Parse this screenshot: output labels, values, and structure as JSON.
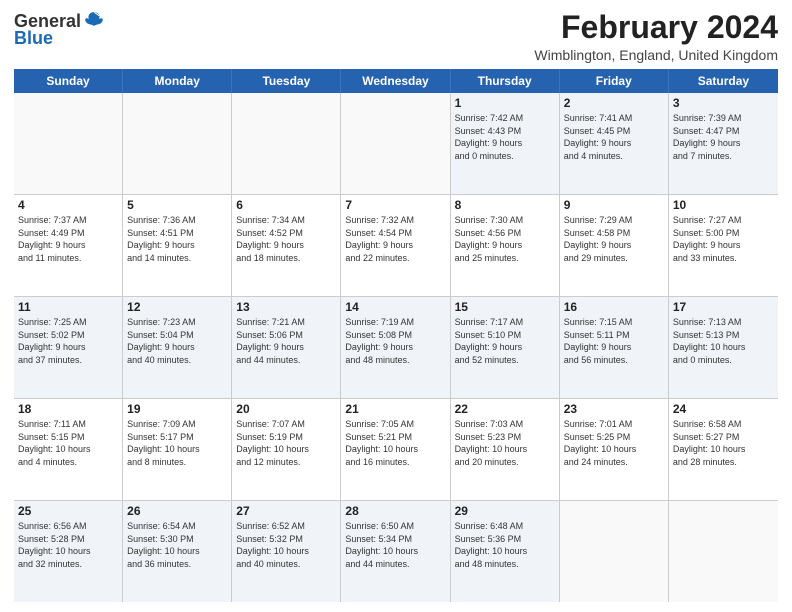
{
  "header": {
    "logo_general": "General",
    "logo_blue": "Blue",
    "month_year": "February 2024",
    "location": "Wimblington, England, United Kingdom"
  },
  "days_of_week": [
    "Sunday",
    "Monday",
    "Tuesday",
    "Wednesday",
    "Thursday",
    "Friday",
    "Saturday"
  ],
  "weeks": [
    [
      {
        "day": "",
        "info": ""
      },
      {
        "day": "",
        "info": ""
      },
      {
        "day": "",
        "info": ""
      },
      {
        "day": "",
        "info": ""
      },
      {
        "day": "1",
        "info": "Sunrise: 7:42 AM\nSunset: 4:43 PM\nDaylight: 9 hours\nand 0 minutes."
      },
      {
        "day": "2",
        "info": "Sunrise: 7:41 AM\nSunset: 4:45 PM\nDaylight: 9 hours\nand 4 minutes."
      },
      {
        "day": "3",
        "info": "Sunrise: 7:39 AM\nSunset: 4:47 PM\nDaylight: 9 hours\nand 7 minutes."
      }
    ],
    [
      {
        "day": "4",
        "info": "Sunrise: 7:37 AM\nSunset: 4:49 PM\nDaylight: 9 hours\nand 11 minutes."
      },
      {
        "day": "5",
        "info": "Sunrise: 7:36 AM\nSunset: 4:51 PM\nDaylight: 9 hours\nand 14 minutes."
      },
      {
        "day": "6",
        "info": "Sunrise: 7:34 AM\nSunset: 4:52 PM\nDaylight: 9 hours\nand 18 minutes."
      },
      {
        "day": "7",
        "info": "Sunrise: 7:32 AM\nSunset: 4:54 PM\nDaylight: 9 hours\nand 22 minutes."
      },
      {
        "day": "8",
        "info": "Sunrise: 7:30 AM\nSunset: 4:56 PM\nDaylight: 9 hours\nand 25 minutes."
      },
      {
        "day": "9",
        "info": "Sunrise: 7:29 AM\nSunset: 4:58 PM\nDaylight: 9 hours\nand 29 minutes."
      },
      {
        "day": "10",
        "info": "Sunrise: 7:27 AM\nSunset: 5:00 PM\nDaylight: 9 hours\nand 33 minutes."
      }
    ],
    [
      {
        "day": "11",
        "info": "Sunrise: 7:25 AM\nSunset: 5:02 PM\nDaylight: 9 hours\nand 37 minutes."
      },
      {
        "day": "12",
        "info": "Sunrise: 7:23 AM\nSunset: 5:04 PM\nDaylight: 9 hours\nand 40 minutes."
      },
      {
        "day": "13",
        "info": "Sunrise: 7:21 AM\nSunset: 5:06 PM\nDaylight: 9 hours\nand 44 minutes."
      },
      {
        "day": "14",
        "info": "Sunrise: 7:19 AM\nSunset: 5:08 PM\nDaylight: 9 hours\nand 48 minutes."
      },
      {
        "day": "15",
        "info": "Sunrise: 7:17 AM\nSunset: 5:10 PM\nDaylight: 9 hours\nand 52 minutes."
      },
      {
        "day": "16",
        "info": "Sunrise: 7:15 AM\nSunset: 5:11 PM\nDaylight: 9 hours\nand 56 minutes."
      },
      {
        "day": "17",
        "info": "Sunrise: 7:13 AM\nSunset: 5:13 PM\nDaylight: 10 hours\nand 0 minutes."
      }
    ],
    [
      {
        "day": "18",
        "info": "Sunrise: 7:11 AM\nSunset: 5:15 PM\nDaylight: 10 hours\nand 4 minutes."
      },
      {
        "day": "19",
        "info": "Sunrise: 7:09 AM\nSunset: 5:17 PM\nDaylight: 10 hours\nand 8 minutes."
      },
      {
        "day": "20",
        "info": "Sunrise: 7:07 AM\nSunset: 5:19 PM\nDaylight: 10 hours\nand 12 minutes."
      },
      {
        "day": "21",
        "info": "Sunrise: 7:05 AM\nSunset: 5:21 PM\nDaylight: 10 hours\nand 16 minutes."
      },
      {
        "day": "22",
        "info": "Sunrise: 7:03 AM\nSunset: 5:23 PM\nDaylight: 10 hours\nand 20 minutes."
      },
      {
        "day": "23",
        "info": "Sunrise: 7:01 AM\nSunset: 5:25 PM\nDaylight: 10 hours\nand 24 minutes."
      },
      {
        "day": "24",
        "info": "Sunrise: 6:58 AM\nSunset: 5:27 PM\nDaylight: 10 hours\nand 28 minutes."
      }
    ],
    [
      {
        "day": "25",
        "info": "Sunrise: 6:56 AM\nSunset: 5:28 PM\nDaylight: 10 hours\nand 32 minutes."
      },
      {
        "day": "26",
        "info": "Sunrise: 6:54 AM\nSunset: 5:30 PM\nDaylight: 10 hours\nand 36 minutes."
      },
      {
        "day": "27",
        "info": "Sunrise: 6:52 AM\nSunset: 5:32 PM\nDaylight: 10 hours\nand 40 minutes."
      },
      {
        "day": "28",
        "info": "Sunrise: 6:50 AM\nSunset: 5:34 PM\nDaylight: 10 hours\nand 44 minutes."
      },
      {
        "day": "29",
        "info": "Sunrise: 6:48 AM\nSunset: 5:36 PM\nDaylight: 10 hours\nand 48 minutes."
      },
      {
        "day": "",
        "info": ""
      },
      {
        "day": "",
        "info": ""
      }
    ]
  ]
}
